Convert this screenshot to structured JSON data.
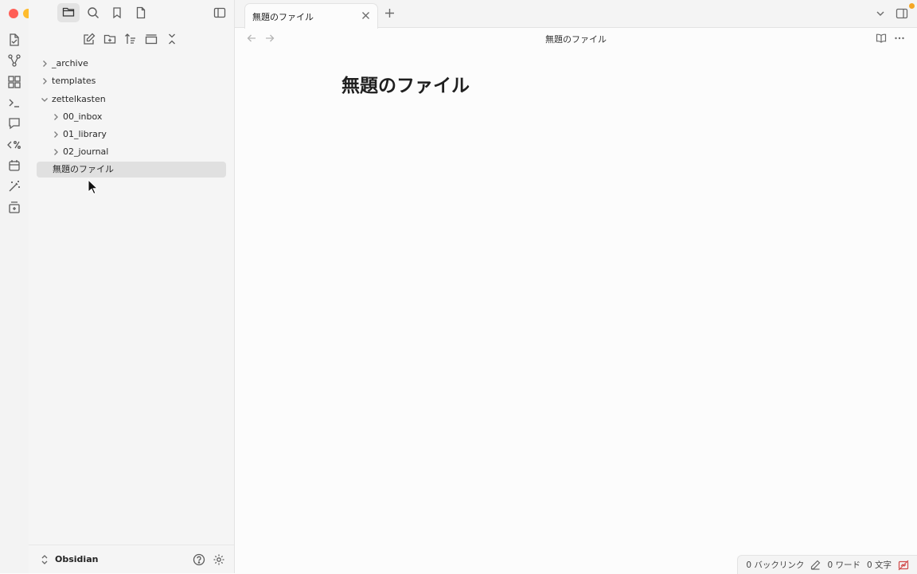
{
  "colors": {
    "close": "#ff5f57",
    "minimize": "#febc2e",
    "zoom": "#28c840",
    "notification": "#f5a623"
  },
  "ribbon": {
    "icons": [
      "switcher-icon",
      "graph-icon",
      "canvas-icon",
      "terminal-icon",
      "chat-icon",
      "templater-icon",
      "calendar-icon",
      "magic-wand-icon",
      "new-card-icon"
    ]
  },
  "file_tree": {
    "items": [
      {
        "label": "_archive",
        "type": "folder",
        "expanded": false,
        "depth": 0
      },
      {
        "label": "templates",
        "type": "folder",
        "expanded": false,
        "depth": 0
      },
      {
        "label": "zettelkasten",
        "type": "folder",
        "expanded": true,
        "depth": 0
      },
      {
        "label": "00_inbox",
        "type": "folder",
        "expanded": false,
        "depth": 1
      },
      {
        "label": "01_library",
        "type": "folder",
        "expanded": false,
        "depth": 1
      },
      {
        "label": "02_journal",
        "type": "folder",
        "expanded": false,
        "depth": 1
      },
      {
        "label": "無題のファイル",
        "type": "file",
        "selected": true,
        "depth": 0
      }
    ]
  },
  "vault": {
    "name": "Obsidian"
  },
  "tab": {
    "title": "無題のファイル"
  },
  "view": {
    "header_title": "無題のファイル",
    "note_title": "無題のファイル"
  },
  "status": {
    "backlinks": "0 バックリンク",
    "words": "0 ワード",
    "chars": "0 文字"
  }
}
